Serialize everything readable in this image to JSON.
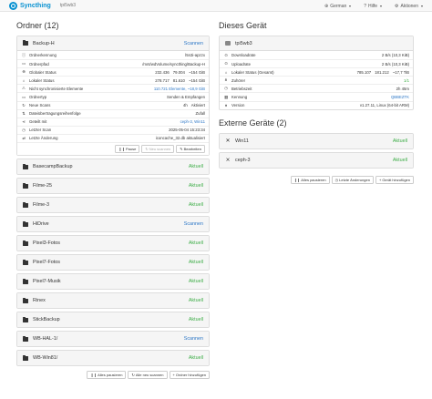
{
  "navbar": {
    "brand": "Syncthing",
    "device_name": "tpi5wb3",
    "language": "German",
    "help": "Hilfe",
    "actions": "Aktionen"
  },
  "folders": {
    "heading": "Ordner (12)",
    "expanded": {
      "name": "Backup-H",
      "status": "Scannen",
      "rows": [
        {
          "icon": "info-icon",
          "glyph": "ⓘ",
          "label": "Ordnerkennung",
          "value": "l5n3i-apzzx"
        },
        {
          "icon": "folder-open-icon",
          "glyph": "▭",
          "label": "Ordnerpfad",
          "value": "/mnt/wdVolume/syncthing/Backup-H"
        },
        {
          "icon": "globe-icon",
          "glyph": "⊕",
          "label": "Globaler Status",
          "parts": [
            "232.436",
            "79.004",
            "~154 GiB"
          ]
        },
        {
          "icon": "home-icon",
          "glyph": "⌂",
          "label": "Lokaler Status",
          "parts": [
            "278.717",
            "81.610",
            "~154 GiB"
          ]
        },
        {
          "icon": "warning-icon",
          "glyph": "⚠",
          "label": "Nicht synchronisierte Elemente",
          "value": "110.721 Elemente, ~18,9 GiB",
          "link": true
        },
        {
          "icon": "folder-type-icon",
          "glyph": "▭",
          "label": "Ordnertyp",
          "value": "Senden & Empfangen"
        },
        {
          "icon": "refresh-icon",
          "glyph": "↻",
          "label": "Neue Scans",
          "parts": [
            "4h",
            "Aktiviert"
          ]
        },
        {
          "icon": "sort-icon",
          "glyph": "⇅",
          "label": "Dateiübertragungsreihenfolge",
          "value": "Zufall"
        },
        {
          "icon": "share-icon",
          "glyph": "⋖",
          "label": "Geteilt mit",
          "value": "ceph-3, Win11",
          "link": true
        },
        {
          "icon": "clock-icon",
          "glyph": "◷",
          "label": "Letzter Scan",
          "value": "2025-05-04 15:23:34"
        },
        {
          "icon": "exchange-icon",
          "glyph": "⇄",
          "label": "Letzte Änderung",
          "value": "iconcache_32.db aktualisiert"
        }
      ],
      "buttons": {
        "pause": "Pause",
        "rescan": "Neu scannen",
        "edit": "Bearbeiten"
      }
    },
    "list": [
      {
        "name": "BasecampBackup",
        "status": "Aktuell"
      },
      {
        "name": "Filme-25",
        "status": "Aktuell"
      },
      {
        "name": "Filme-3",
        "status": "Aktuell"
      },
      {
        "name": "HiDrive",
        "status": "Scannen"
      },
      {
        "name": "Pixel3-Fotos",
        "status": "Aktuell"
      },
      {
        "name": "Pixel7-Fotos",
        "status": "Aktuell"
      },
      {
        "name": "Pixel7-Musik",
        "status": "Aktuell"
      },
      {
        "name": "Rinex",
        "status": "Aktuell"
      },
      {
        "name": "StickBackup",
        "status": "Aktuell"
      },
      {
        "name": "WB-HAL-1/",
        "status": "Scannen"
      },
      {
        "name": "WB-Win81/",
        "status": "Aktuell"
      }
    ],
    "footer_buttons": {
      "pause_all": "Alles pausieren",
      "rescan_all": "Alle neu scannen",
      "add_folder": "Ordner hinzufügen"
    }
  },
  "this_device": {
    "heading": "Dieses Gerät",
    "name": "tpi5wb3",
    "rows": [
      {
        "icon": "download-icon",
        "glyph": "⊙",
        "label": "Downloadrate",
        "value": "2 B/s (10,3 KiB)"
      },
      {
        "icon": "upload-icon",
        "glyph": "⊙",
        "label": "Uploadrate",
        "value": "2 B/s (10,3 KiB)"
      },
      {
        "icon": "home-icon",
        "glyph": "⌂",
        "label": "Lokaler Status (Gesamt)",
        "parts": [
          "785.107",
          "181.212",
          "~17,7 TiB"
        ]
      },
      {
        "icon": "network-icon",
        "glyph": "⋔",
        "label": "Zuhörer",
        "value": "1/1",
        "green": true
      },
      {
        "icon": "clock-icon",
        "glyph": "◷",
        "label": "Betriebszeit",
        "value": "2h 45m"
      },
      {
        "icon": "qrcode-icon",
        "glyph": "▦",
        "label": "Kennung",
        "value": "QBBEZTK",
        "link": true
      },
      {
        "icon": "tag-icon",
        "glyph": "⬧",
        "label": "Version",
        "value": "v1.27.11, Linux (64-bit ARM)"
      }
    ]
  },
  "remote_devices": {
    "heading": "Externe Geräte (2)",
    "list": [
      {
        "name": "Win11",
        "status": "Aktuell"
      },
      {
        "name": "ceph-3",
        "status": "Aktuell"
      }
    ],
    "footer_buttons": {
      "pause_all": "Alles pausieren",
      "recent_changes": "Letzte Änderungen",
      "add_device": "Gerät hinzufügen"
    }
  },
  "colors": {
    "accent": "#0891d1",
    "ok": "#3fae49",
    "scan": "#2e78c7"
  }
}
